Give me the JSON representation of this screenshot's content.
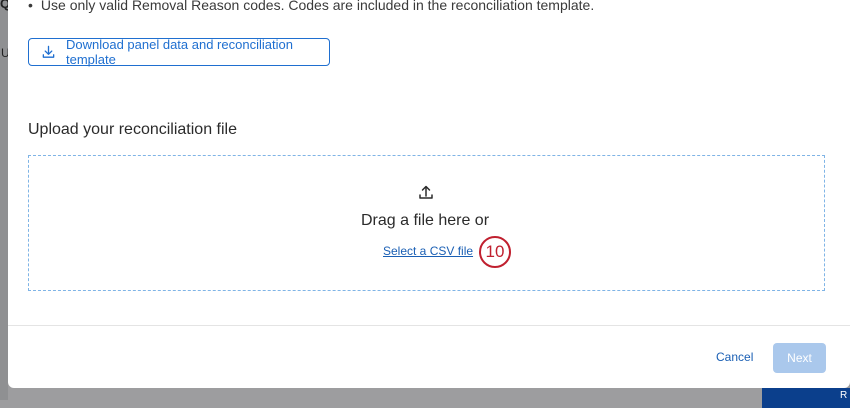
{
  "backdrop": {
    "left_char_top": "Q",
    "left_char_mid": "U",
    "right_btn_text": "R"
  },
  "modal": {
    "note": "Use only valid Removal Reason codes. Codes are included in the reconciliation template.",
    "download_button": {
      "label": "Download panel data and reconciliation template",
      "icon": "download-icon"
    },
    "upload_section": {
      "title": "Upload your reconciliation file",
      "drag_text": "Drag a file here or",
      "select_link": "Select a CSV file",
      "icon": "upload-icon"
    },
    "step_badge": "10",
    "footer": {
      "cancel_label": "Cancel",
      "next_label": "Next"
    }
  },
  "colors": {
    "accent": "#1f6fd0",
    "badge": "#c0202f",
    "next_disabled": "#aac8ec",
    "dropzone_border": "#7fb4e6"
  }
}
